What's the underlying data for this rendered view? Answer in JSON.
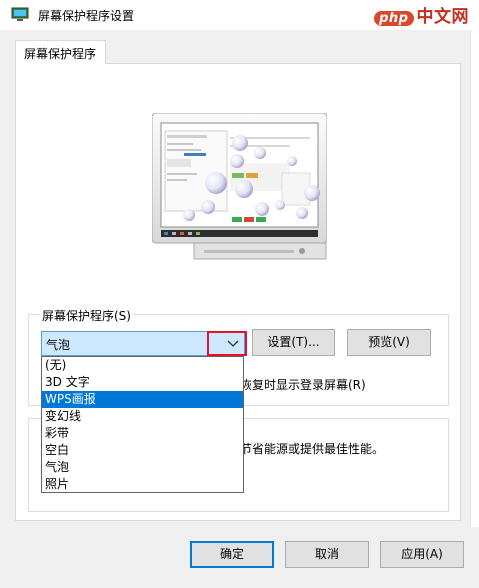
{
  "window": {
    "title": "屏幕保护程序设置"
  },
  "watermark": {
    "logo": "php",
    "text": "中文网"
  },
  "tabs": [
    {
      "label": "屏幕保护程序"
    }
  ],
  "screensaver": {
    "group_label": "屏幕保护程序(S)",
    "selected": "气泡",
    "settings_button": "设置(T)...",
    "preview_button": "预览(V)",
    "options": [
      "(无)",
      "3D 文字",
      "WPS画报",
      "变幻线",
      "彩带",
      "空白",
      "气泡",
      "照片"
    ],
    "highlighted_option": "WPS画报",
    "logon_text_partial": "恢复时显示登录屏幕(R)"
  },
  "power": {
    "text_partial": "节省能源或提供最佳性能。"
  },
  "footer": {
    "ok": "确定",
    "cancel": "取消",
    "apply": "应用(A)"
  },
  "colors": {
    "accent": "#0078d7",
    "highlight_box": "#e81123",
    "combo_bg": "#cde8ff"
  }
}
